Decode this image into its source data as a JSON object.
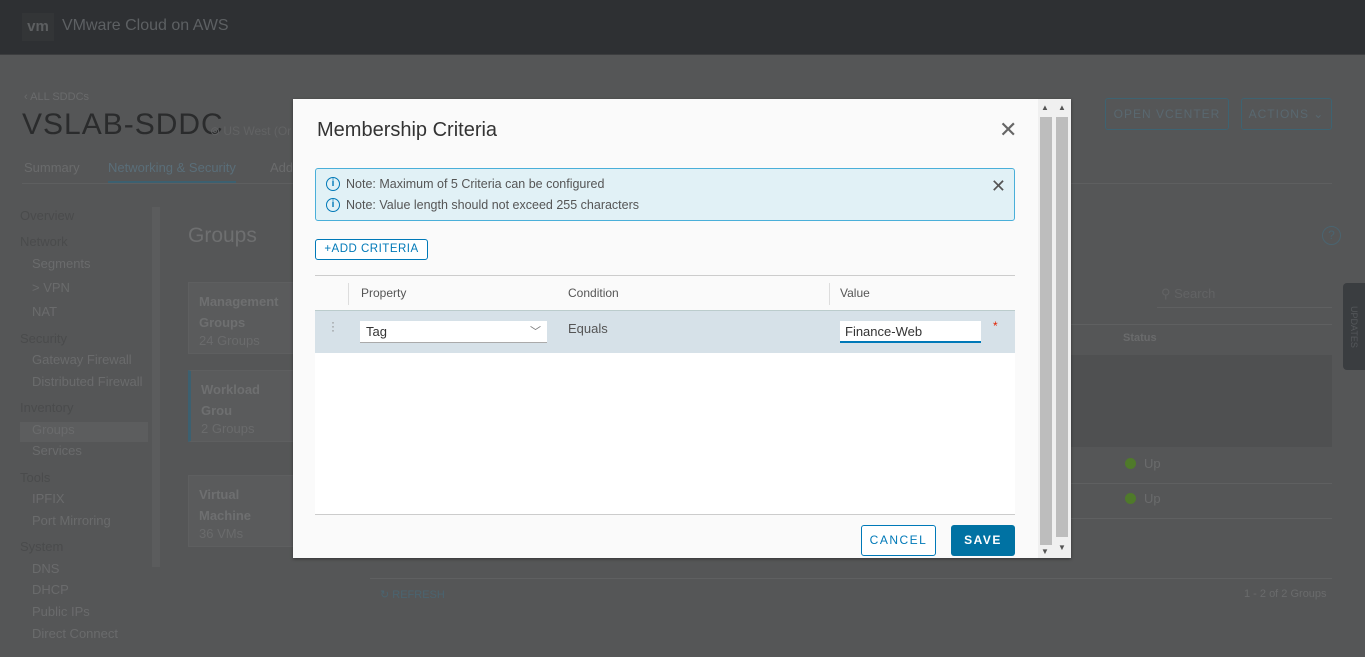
{
  "app": {
    "logo": "vm",
    "title": "VMware Cloud on AWS"
  },
  "page": {
    "back_link": "ALL SDDCs",
    "sddc_name": "VSLAB-SDDC",
    "region": "US West (Or",
    "open_vcenter": "OPEN VCENTER",
    "actions": "ACTIONS"
  },
  "tabs": [
    {
      "label": "Summary"
    },
    {
      "label": "Networking & Security",
      "active": true
    },
    {
      "label": "Add"
    }
  ],
  "nav": {
    "items": [
      {
        "label": "Overview",
        "type": "h"
      },
      {
        "label": "Network",
        "type": "h"
      },
      {
        "label": "Segments",
        "type": "i"
      },
      {
        "label": ">   VPN",
        "type": "i"
      },
      {
        "label": "NAT",
        "type": "i"
      },
      {
        "label": "Security",
        "type": "h"
      },
      {
        "label": "Gateway Firewall",
        "type": "i"
      },
      {
        "label": "Distributed Firewall",
        "type": "i"
      },
      {
        "label": "Inventory",
        "type": "h"
      },
      {
        "label": "Groups",
        "type": "i",
        "selected": true
      },
      {
        "label": "Services",
        "type": "i"
      },
      {
        "label": "Tools",
        "type": "h"
      },
      {
        "label": "IPFIX",
        "type": "i"
      },
      {
        "label": "Port Mirroring",
        "type": "i"
      },
      {
        "label": "System",
        "type": "h"
      },
      {
        "label": "DNS",
        "type": "i"
      },
      {
        "label": "DHCP",
        "type": "i"
      },
      {
        "label": "Public IPs",
        "type": "i"
      },
      {
        "label": "Direct Connect",
        "type": "i"
      }
    ]
  },
  "groups": {
    "title": "Groups",
    "cards": [
      {
        "title": "Management Groups",
        "count": "24 Groups"
      },
      {
        "title": "Workload Grou",
        "count": "2 Groups"
      },
      {
        "title": "Virtual Machine",
        "count": "36 VMs"
      }
    ],
    "search_placeholder": "Search",
    "status_header": "Status",
    "statuses": [
      "Up",
      "Up"
    ],
    "refresh": "REFRESH",
    "pagination": "1 - 2 of 2 Groups",
    "updates_tab": "UPDATES"
  },
  "modal": {
    "title": "Membership Criteria",
    "notes": [
      "Note: Maximum of 5 Criteria can be configured",
      "Note: Value length should not exceed 255 characters"
    ],
    "add_criteria": "+ADD CRITERIA",
    "columns": [
      "Property",
      "Condition",
      "Value"
    ],
    "row": {
      "property": "Tag",
      "condition": "Equals",
      "value": "Finance-Web"
    },
    "cancel": "CANCEL",
    "save": "SAVE"
  },
  "colors": {
    "primary": "#0072a3",
    "info_bg": "#e1f1f6",
    "status_up": "#4f7a2a"
  }
}
